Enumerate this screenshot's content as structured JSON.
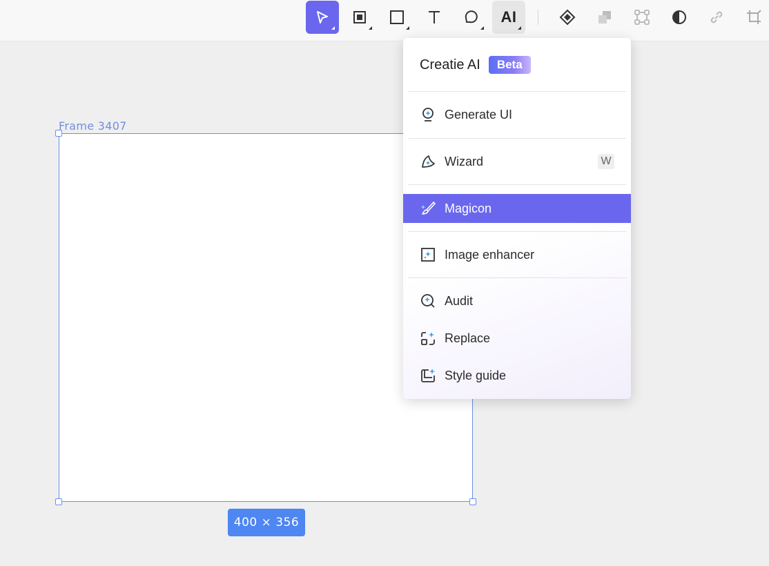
{
  "toolbar": {
    "ai_label": "AI",
    "tools": [
      "select-tool",
      "frame-tool",
      "rectangle-tool",
      "text-tool",
      "comment-tool",
      "ai-tool",
      "component-tool",
      "boolean-tool",
      "transform-tool",
      "mask-tool",
      "link-tool",
      "crop-tool"
    ]
  },
  "canvas": {
    "frame_name": "Frame 3407",
    "frame_size": "400 × 356"
  },
  "ai_menu": {
    "title": "Creatie AI",
    "badge": "Beta",
    "items": [
      {
        "label": "Generate UI",
        "icon": "generate-ui-icon",
        "shortcut": ""
      },
      {
        "label": "Wizard",
        "icon": "wizard-icon",
        "shortcut": "W"
      },
      {
        "label": "Magicon",
        "icon": "magicon-brush-icon",
        "shortcut": ""
      },
      {
        "label": "Image enhancer",
        "icon": "image-enhancer-icon",
        "shortcut": ""
      },
      {
        "label": "Audit",
        "icon": "audit-icon",
        "shortcut": ""
      },
      {
        "label": "Replace",
        "icon": "replace-icon",
        "shortcut": ""
      },
      {
        "label": "Style guide",
        "icon": "style-guide-icon",
        "shortcut": ""
      }
    ]
  },
  "colors": {
    "accent": "#6a67ee",
    "selection": "#6a8ff0",
    "badge": "#4e86f2"
  }
}
